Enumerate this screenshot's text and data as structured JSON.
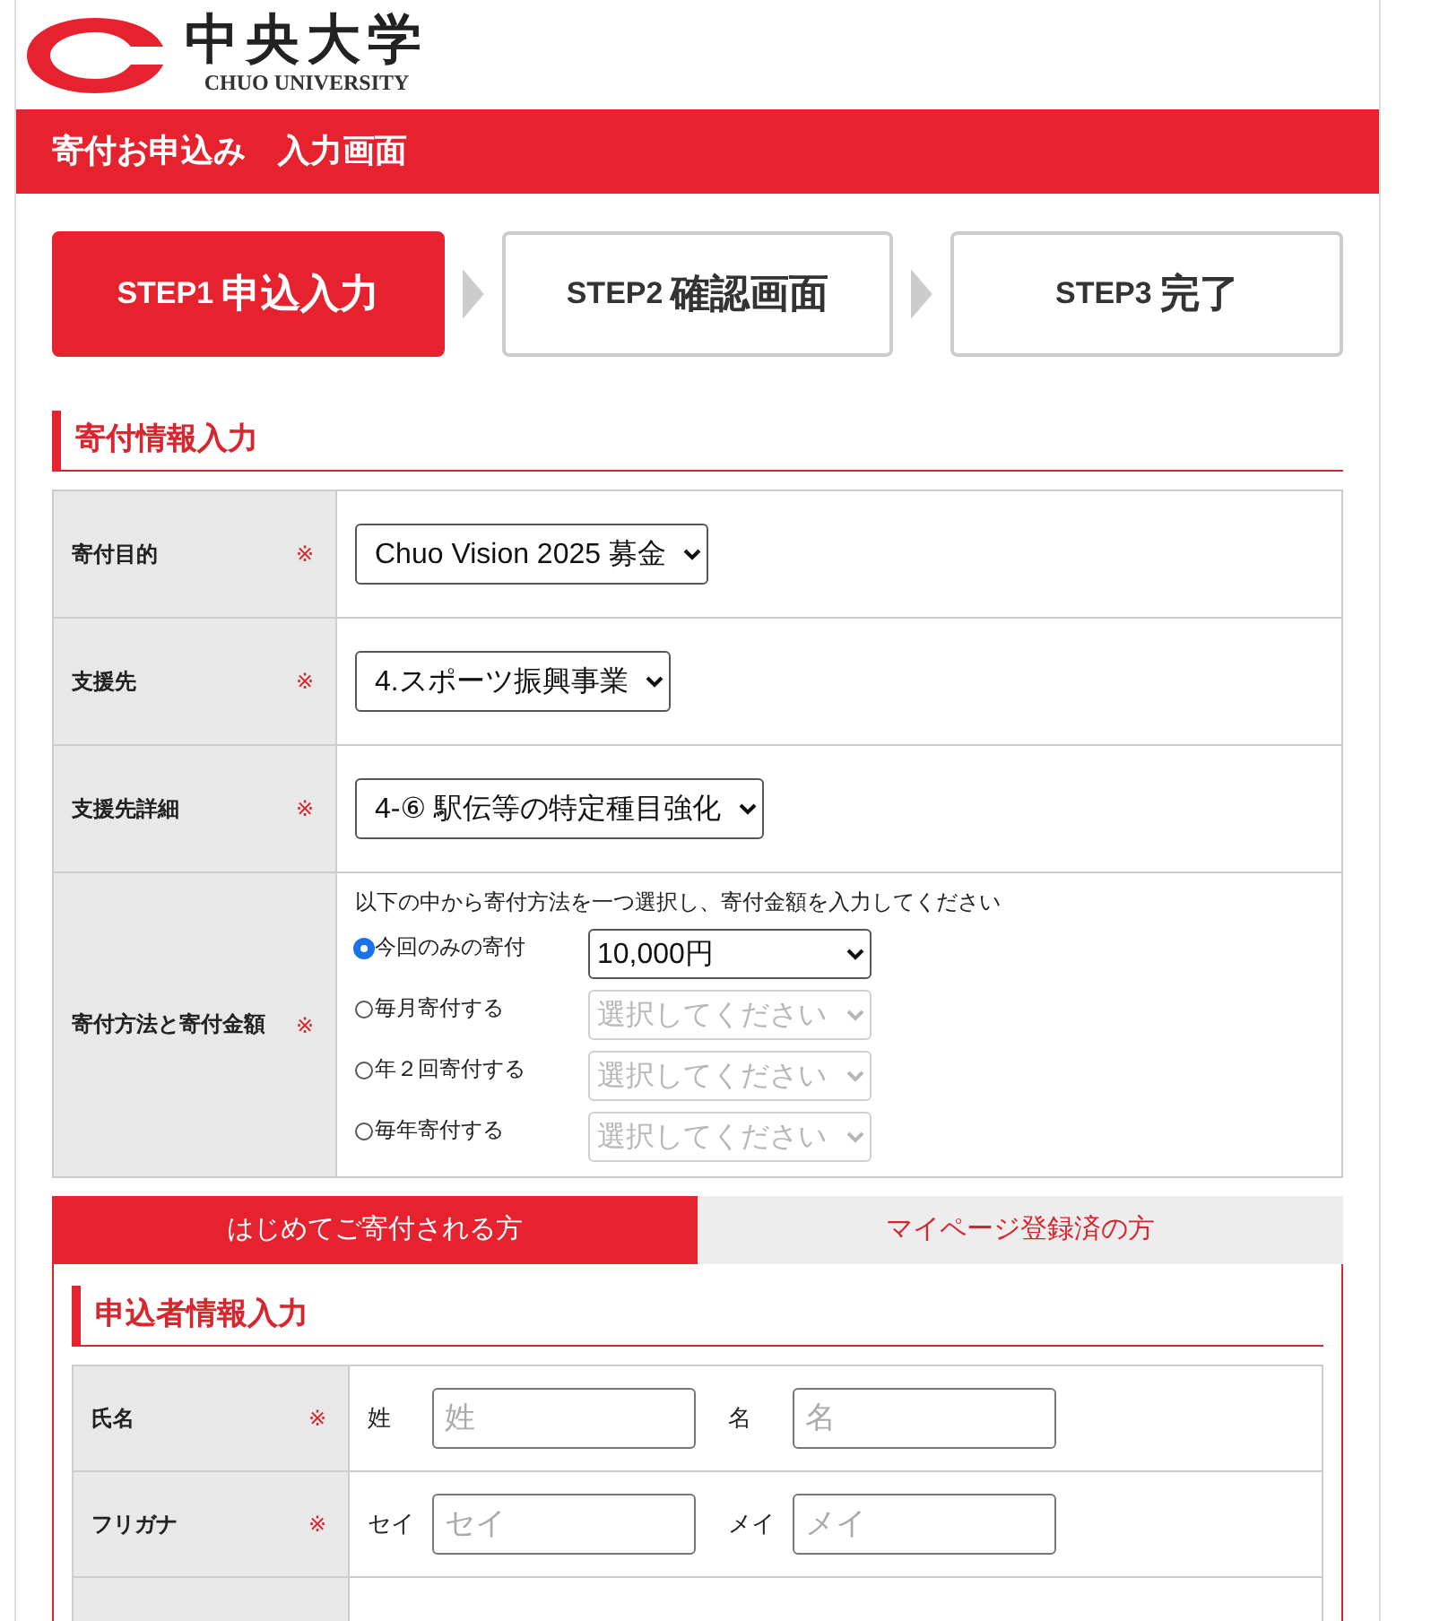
{
  "header": {
    "logo_title": "中央大学",
    "logo_subtitle": "CHUO UNIVERSITY"
  },
  "page_title": "寄付お申込み　入力画面",
  "steps": [
    {
      "prefix": "STEP1",
      "label": "申込入力",
      "selected": true
    },
    {
      "prefix": "STEP2",
      "label": "確認画面",
      "selected": false
    },
    {
      "prefix": "STEP3",
      "label": "完了",
      "selected": false
    }
  ],
  "donation_section": {
    "heading": "寄付情報入力",
    "rows": [
      {
        "kind": "select",
        "label": "寄付目的",
        "required_mark": "※",
        "value": "Chuo Vision 2025 募金"
      },
      {
        "kind": "select",
        "label": "支援先",
        "required_mark": "※",
        "value": "4.スポーツ振興事業"
      },
      {
        "kind": "select",
        "label": "支援先詳細",
        "required_mark": "※",
        "value": "4-⑥ 駅伝等の特定種目強化"
      },
      {
        "kind": "methods",
        "label": "寄付方法と寄付金額",
        "required_mark": "※",
        "instruction": "以下の中から寄付方法を一つ選択し、寄付金額を入力してください",
        "options": [
          {
            "label": "今回のみの寄付",
            "selected": true,
            "amount": "10,000円",
            "disabled": false
          },
          {
            "label": "毎月寄付する",
            "selected": false,
            "amount": "選択してください",
            "disabled": true
          },
          {
            "label": "年２回寄付する",
            "selected": false,
            "amount": "選択してください",
            "disabled": true
          },
          {
            "label": "毎年寄付する",
            "selected": false,
            "amount": "選択してください",
            "disabled": true
          }
        ]
      }
    ]
  },
  "applicant_tabs": [
    {
      "label": "はじめてご寄付される方",
      "selected": true
    },
    {
      "label": "マイページ登録済の方",
      "selected": false
    }
  ],
  "applicant_section": {
    "heading": "申込者情報入力",
    "rows": [
      {
        "label": "氏名",
        "required_mark": "※",
        "fields": [
          {
            "label": "姓",
            "placeholder": "姓"
          },
          {
            "label": "名",
            "placeholder": "名"
          }
        ]
      },
      {
        "label": "フリガナ",
        "required_mark": "※",
        "fields": [
          {
            "label": "セイ",
            "placeholder": "セイ"
          },
          {
            "label": "メイ",
            "placeholder": "メイ"
          }
        ]
      }
    ]
  }
}
